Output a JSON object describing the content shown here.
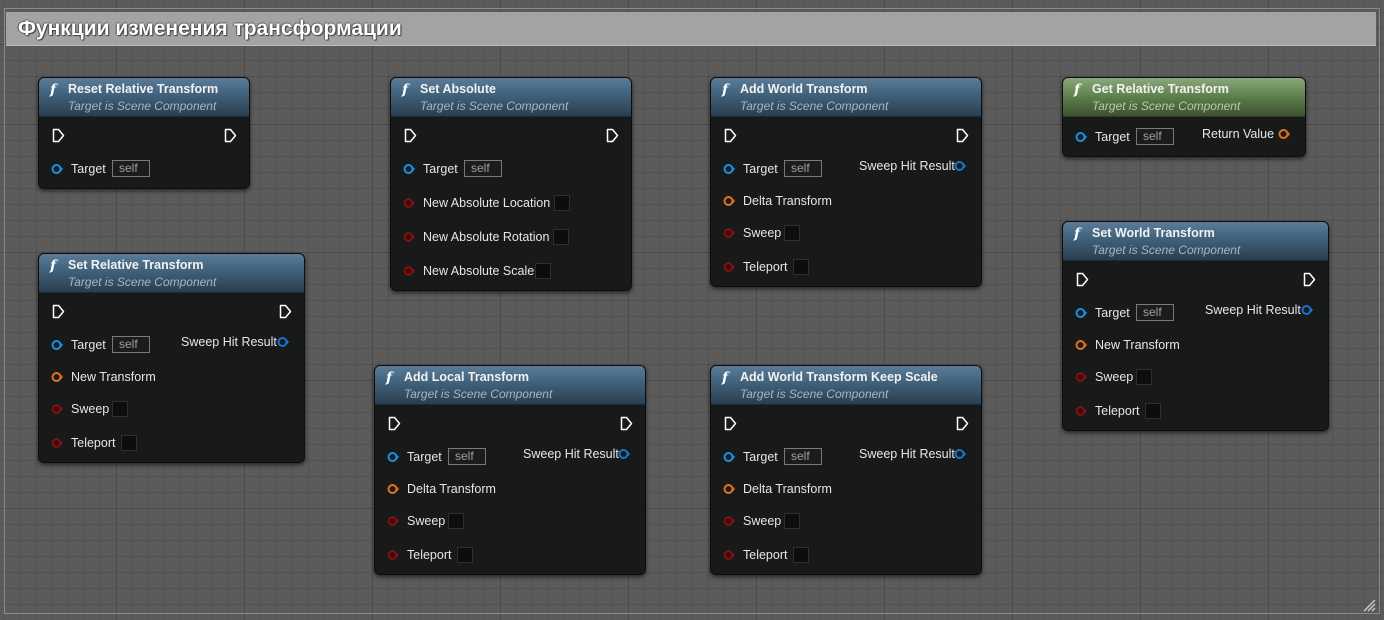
{
  "comment": {
    "title": "Функции изменения трансформации"
  },
  "nodes": [
    {
      "title": "Reset Relative Transform",
      "subtitle": "Target is Scene Component",
      "pins": [
        {
          "label": "Target",
          "value": "self"
        }
      ]
    },
    {
      "title": "Set Absolute",
      "subtitle": "Target is Scene Component",
      "pins": [
        {
          "label": "Target",
          "value": "self"
        },
        {
          "label": "New Absolute Location"
        },
        {
          "label": "New Absolute Rotation"
        },
        {
          "label": "New Absolute Scale"
        }
      ]
    },
    {
      "title": "Add World Transform",
      "subtitle": "Target is Scene Component",
      "pins": [
        {
          "label": "Target",
          "value": "self"
        },
        {
          "label": "Delta Transform"
        },
        {
          "label": "Sweep"
        },
        {
          "label": "Teleport"
        }
      ],
      "outputs": [
        {
          "label": "Sweep Hit Result"
        }
      ]
    },
    {
      "title": "Get Relative Transform",
      "subtitle": "Target is Scene Component",
      "pins": [
        {
          "label": "Target",
          "value": "self"
        }
      ],
      "outputs": [
        {
          "label": "Return Value"
        }
      ]
    },
    {
      "title": "Set Relative Transform",
      "subtitle": "Target is Scene Component",
      "pins": [
        {
          "label": "Target",
          "value": "self"
        },
        {
          "label": "New Transform"
        },
        {
          "label": "Sweep"
        },
        {
          "label": "Teleport"
        }
      ],
      "outputs": [
        {
          "label": "Sweep Hit Result"
        }
      ]
    },
    {
      "title": "Add Local Transform",
      "subtitle": "Target is Scene Component",
      "pins": [
        {
          "label": "Target",
          "value": "self"
        },
        {
          "label": "Delta Transform"
        },
        {
          "label": "Sweep"
        },
        {
          "label": "Teleport"
        }
      ],
      "outputs": [
        {
          "label": "Sweep Hit Result"
        }
      ]
    },
    {
      "title": "Add World Transform Keep Scale",
      "subtitle": "Target is Scene Component",
      "pins": [
        {
          "label": "Target",
          "value": "self"
        },
        {
          "label": "Delta Transform"
        },
        {
          "label": "Sweep"
        },
        {
          "label": "Teleport"
        }
      ],
      "outputs": [
        {
          "label": "Sweep Hit Result"
        }
      ]
    },
    {
      "title": "Set World Transform",
      "subtitle": "Target is Scene Component",
      "pins": [
        {
          "label": "Target",
          "value": "self"
        },
        {
          "label": "New Transform"
        },
        {
          "label": "Sweep"
        },
        {
          "label": "Teleport"
        }
      ],
      "outputs": [
        {
          "label": "Sweep Hit Result"
        }
      ]
    }
  ],
  "colors": {
    "object_pin": "#1d8fe0",
    "struct_pin": "#e2711f",
    "bool_pin": "#8e0f0f",
    "function_header": "#3b5b74",
    "pure_function_header": "#587a48"
  },
  "icons": {
    "exec": "exec-pin-icon",
    "object": "object-pin-icon",
    "struct": "struct-pin-icon",
    "bool": "bool-pin-icon",
    "function": "function-icon"
  }
}
